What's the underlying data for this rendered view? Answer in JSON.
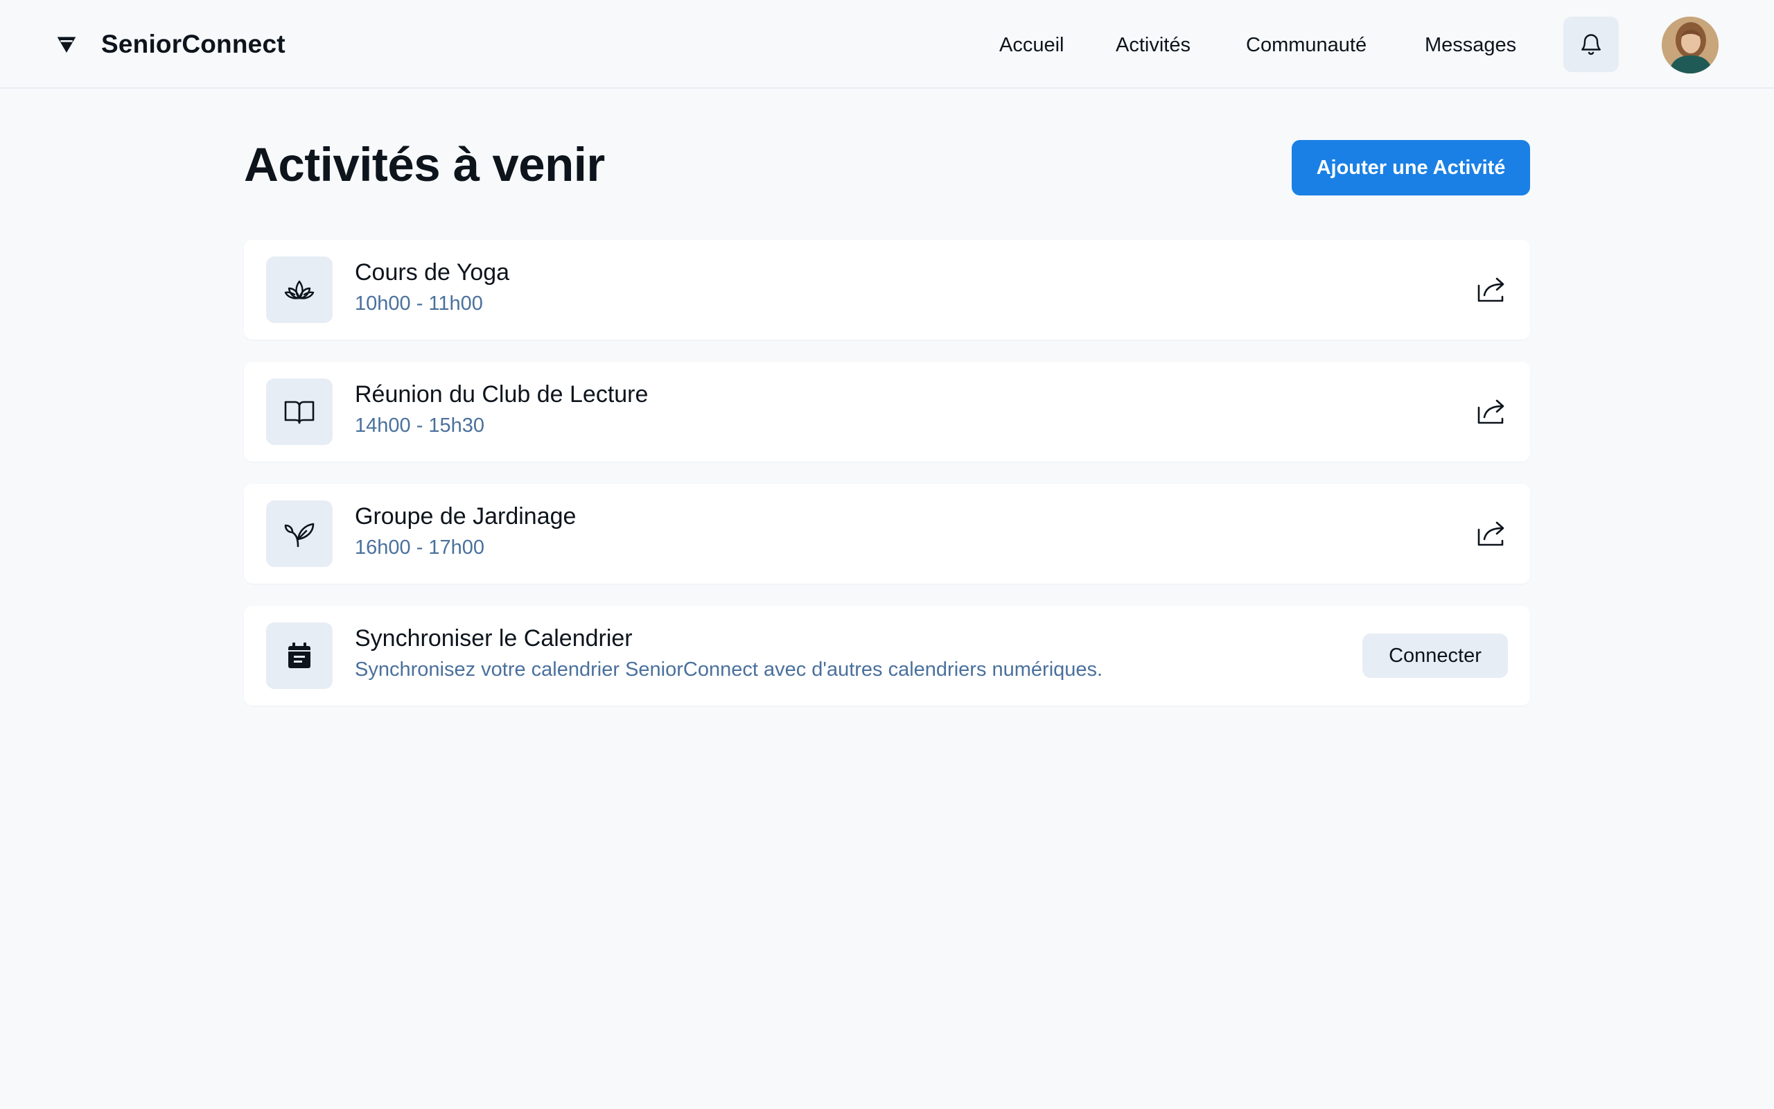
{
  "app": {
    "name": "SeniorConnect"
  },
  "nav": {
    "items": [
      "Accueil",
      "Activités",
      "Communauté",
      "Messages"
    ]
  },
  "icons": {
    "logo": "triangle-logo-icon",
    "notifications": "bell-icon",
    "share": "share-icon"
  },
  "page": {
    "title": "Activités à venir",
    "add_button": "Ajouter une Activité"
  },
  "activities": [
    {
      "title": "Cours de Yoga",
      "time": "10h00 - 11h00",
      "icon": "lotus-icon"
    },
    {
      "title": "Réunion du Club de Lecture",
      "time": "14h00 - 15h30",
      "icon": "book-open-icon"
    },
    {
      "title": "Groupe de Jardinage",
      "time": "16h00 - 17h00",
      "icon": "plant-icon"
    }
  ],
  "sync": {
    "title": "Synchroniser le Calendrier",
    "description": "Synchronisez votre calendrier SeniorConnect avec d'autres calendriers numériques.",
    "button": "Connecter",
    "icon": "calendar-icon"
  },
  "colors": {
    "accent": "#1a80e5",
    "secondary_text": "#4a709c",
    "surface": "#e7edf4",
    "background": "#f7f9fb"
  }
}
